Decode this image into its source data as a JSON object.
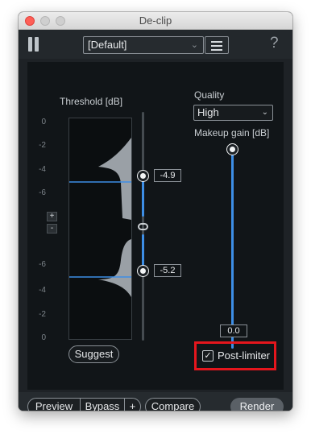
{
  "window": {
    "title": "De-clip"
  },
  "topbar": {
    "preset_value": "[Default]",
    "help_glyph": "?"
  },
  "threshold": {
    "label": "Threshold [dB]",
    "upper_ticks": [
      "0",
      "-2",
      "-4",
      "-6"
    ],
    "lower_ticks": [
      "-6",
      "-4",
      "-2",
      "0"
    ],
    "upper_value": "-4.9",
    "lower_value": "-5.2",
    "plus_label": "+",
    "minus_label": "-",
    "suggest_label": "Suggest"
  },
  "quality": {
    "label": "Quality",
    "selected": "High"
  },
  "makeup_gain": {
    "label": "Makeup gain [dB]",
    "value": "0.0"
  },
  "post_limiter": {
    "label": "Post-limiter",
    "checked": true,
    "highlight_color": "#e5161d"
  },
  "bottombar": {
    "preview_label": "Preview",
    "bypass_label": "Bypass",
    "plus_label": "+",
    "compare_label": "Compare",
    "render_label": "Render"
  },
  "colors": {
    "accent": "#3d8ee6",
    "panel": "#111518",
    "chrome": "#1e2226"
  }
}
